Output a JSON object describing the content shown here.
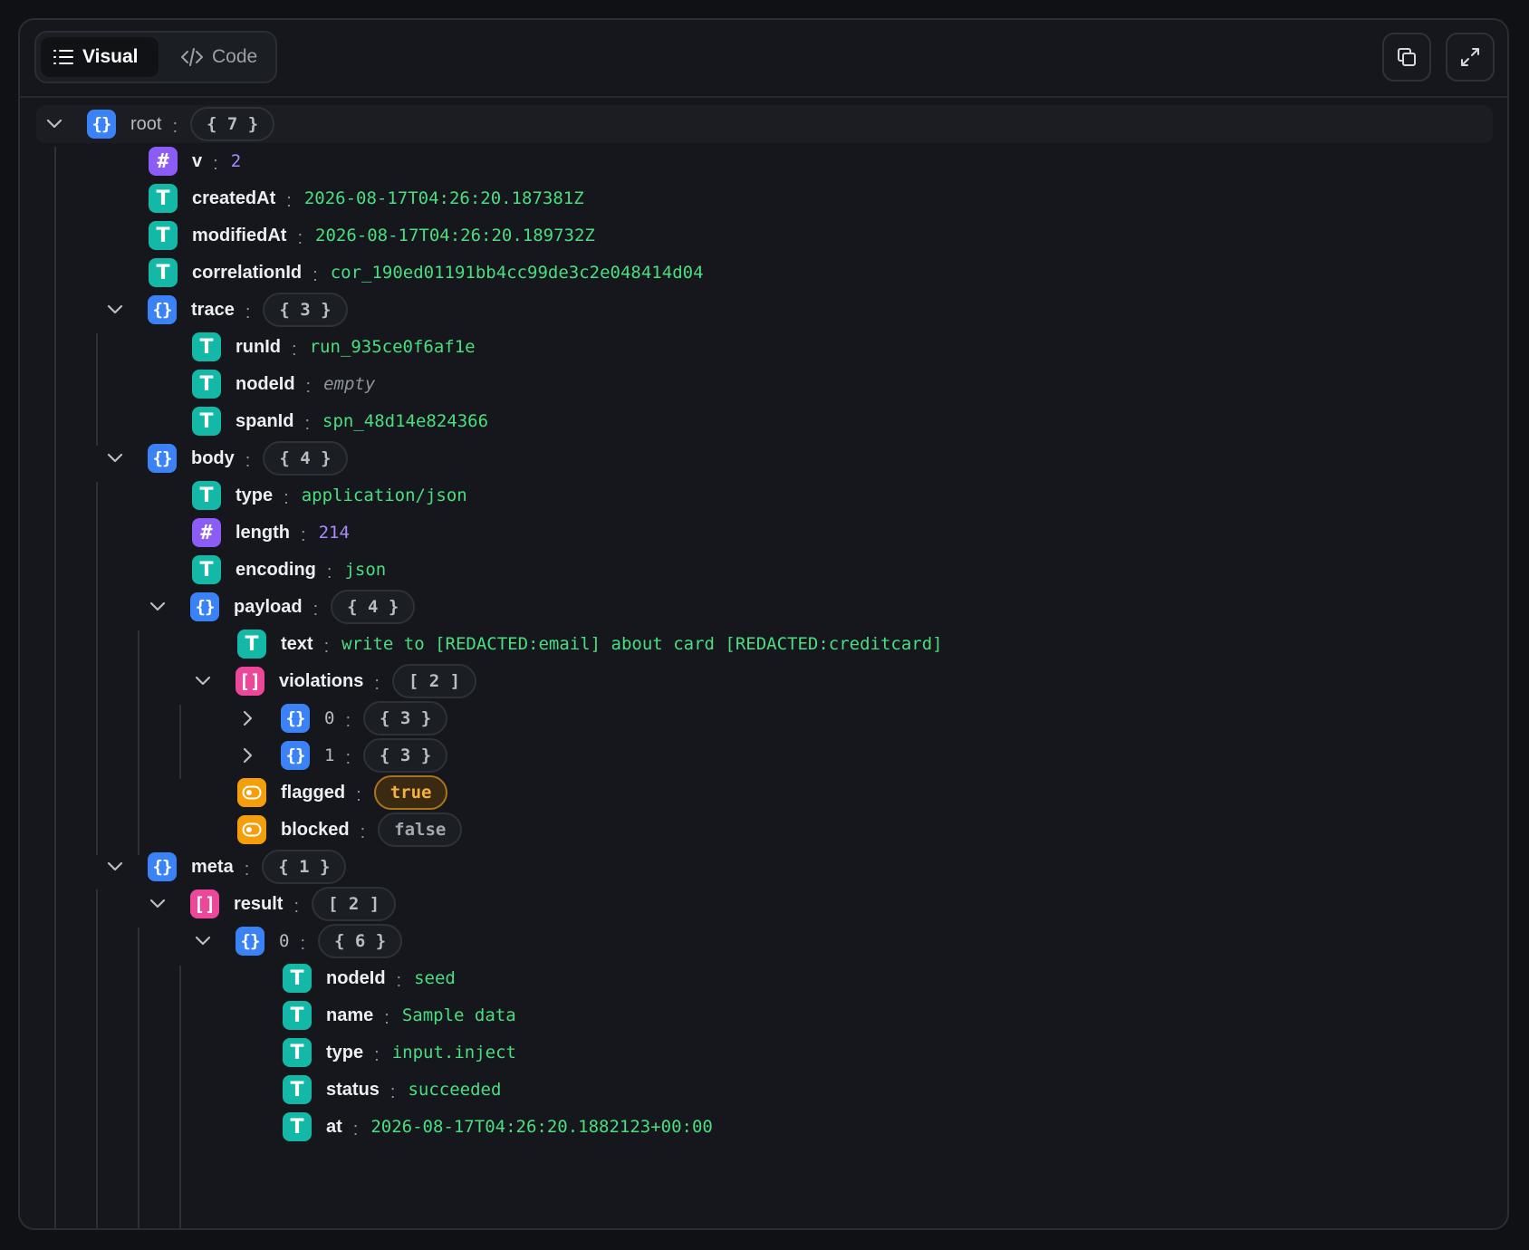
{
  "toolbar": {
    "tab_visual": "Visual",
    "tab_code": "Code",
    "list_icon": "list-icon",
    "code_icon": "code-icon",
    "copy_icon": "copy-icon",
    "expand_icon": "expand-icon"
  },
  "tree": {
    "root_key": "root",
    "root_count": "{ 7 }",
    "v_key": "v",
    "v_val": "2",
    "createdAt_key": "createdAt",
    "createdAt_val": "2026-08-17T04:26:20.187381Z",
    "modifiedAt_key": "modifiedAt",
    "modifiedAt_val": "2026-08-17T04:26:20.189732Z",
    "correlationId_key": "correlationId",
    "correlationId_val": "cor_190ed01191bb4cc99de3c2e048414d04",
    "trace_key": "trace",
    "trace_count": "{ 3 }",
    "runId_key": "runId",
    "runId_val": "run_935ce0f6af1e",
    "nodeId_key": "nodeId",
    "nodeId_val": "empty",
    "spanId_key": "spanId",
    "spanId_val": "spn_48d14e824366",
    "body_key": "body",
    "body_count": "{ 4 }",
    "type_key": "type",
    "type_val": "application/json",
    "length_key": "length",
    "length_val": "214",
    "encoding_key": "encoding",
    "encoding_val": "json",
    "payload_key": "payload",
    "payload_count": "{ 4 }",
    "text_key": "text",
    "text_val": "write to [REDACTED:email] about card [REDACTED:creditcard]",
    "violations_key": "violations",
    "violations_count": "[ 2 ]",
    "v0_key": "0",
    "v0_count": "{ 3 }",
    "v1_key": "1",
    "v1_count": "{ 3 }",
    "flagged_key": "flagged",
    "flagged_val": "true",
    "blocked_key": "blocked",
    "blocked_val": "false",
    "meta_key": "meta",
    "meta_count": "{ 1 }",
    "result_key": "result",
    "result_count": "[ 2 ]",
    "r0_key": "0",
    "r0_count": "{ 6 }",
    "r_nodeId_key": "nodeId",
    "r_nodeId_val": "seed",
    "r_name_key": "name",
    "r_name_val": "Sample data",
    "r_type_key": "type",
    "r_type_val": "input.inject",
    "r_status_key": "status",
    "r_status_val": "succeeded",
    "r_at_key": "at",
    "r_at_val": "2026-08-17T04:26:20.1882123+00:00"
  },
  "colors": {
    "object": "#3b82f6",
    "array": "#ec4899",
    "number": "#8b5cf6",
    "string": "#14b8a6",
    "boolean": "#f59e0b",
    "string_value": "#4ade80"
  }
}
